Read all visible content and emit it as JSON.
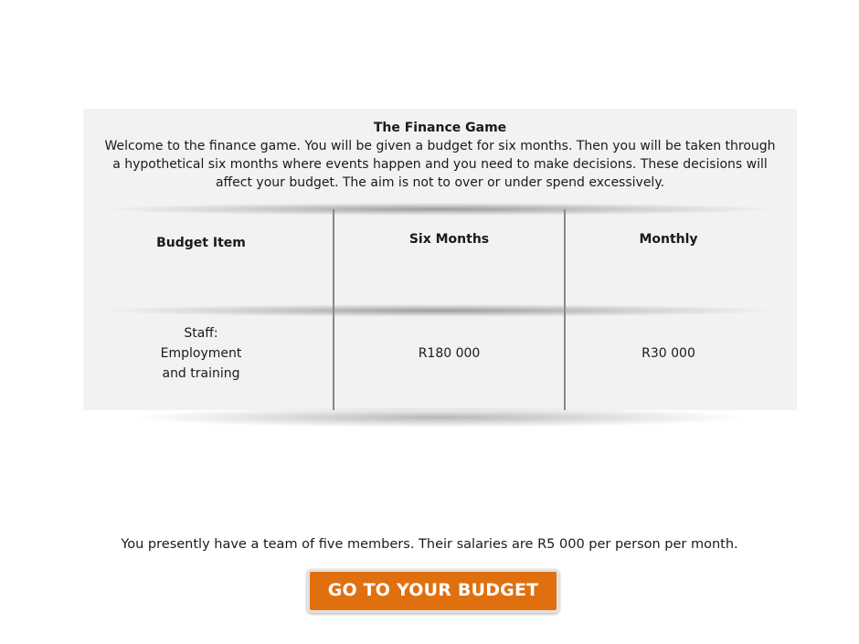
{
  "intro": {
    "title": "The Finance Game",
    "body": "Welcome to the finance game. You will be given a budget for six months. Then you will be taken through a hypothetical six months where events happen and you need to make decisions. These decisions will affect your budget. The aim is not to over or under spend excessively."
  },
  "table": {
    "headers": {
      "item": "Budget Item",
      "six_months": "Six Months",
      "monthly": "Monthly"
    },
    "rows": [
      {
        "item": "Staff:\nEmployment\nand training",
        "six_months": "R180 000",
        "monthly": "R30 000"
      }
    ]
  },
  "footer": {
    "note": "You presently have a team of five members. Their salaries are R5 000 per person per month.",
    "button_label": "GO TO YOUR BUDGET"
  },
  "colors": {
    "panel_bg": "#f2f2f3",
    "button_bg": "#e0700f",
    "button_text": "#ffffff"
  }
}
